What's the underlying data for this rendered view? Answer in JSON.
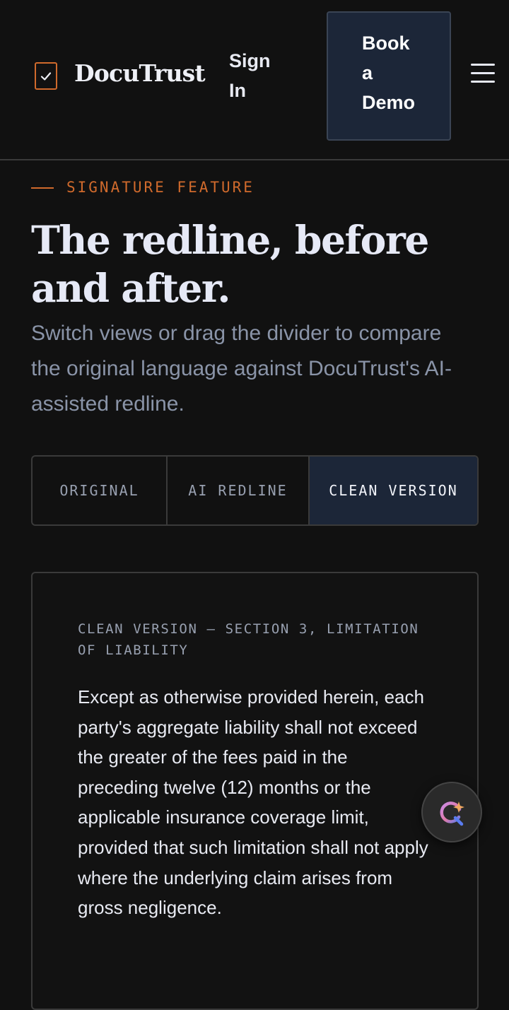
{
  "header": {
    "brand": "DocuTrust",
    "sign_in_line1": "Sign",
    "sign_in_line2": "In",
    "demo_line1": "Book",
    "demo_line2": "a",
    "demo_line3": "Demo",
    "logo_icon": "check-square-icon",
    "menu_icon": "hamburger-menu-icon"
  },
  "hero": {
    "eyebrow": "SIGNATURE FEATURE",
    "title": "The redline, before and after.",
    "subtitle": "Switch views or drag the divider to compare the original language against DocuTrust's AI-assisted redline."
  },
  "tabs": [
    {
      "label": "ORIGINAL",
      "active": false
    },
    {
      "label": "AI REDLINE",
      "active": false
    },
    {
      "label": "CLEAN VERSION",
      "active": true
    }
  ],
  "card": {
    "label": "CLEAN VERSION — SECTION 3, LIMITATION OF LIABILITY",
    "body": "Except as otherwise provided herein, each party's aggregate liability shall not exceed the greater of the fees paid in the preceding twelve (12) months or the applicable insurance coverage limit, provided that such limitation shall not apply where the underlying claim arises from gross negligence."
  },
  "fab": {
    "icon": "ai-assistant-icon"
  },
  "colors": {
    "accent": "#d06a2c",
    "background": "#111111",
    "active_tab": "#1c2638"
  }
}
